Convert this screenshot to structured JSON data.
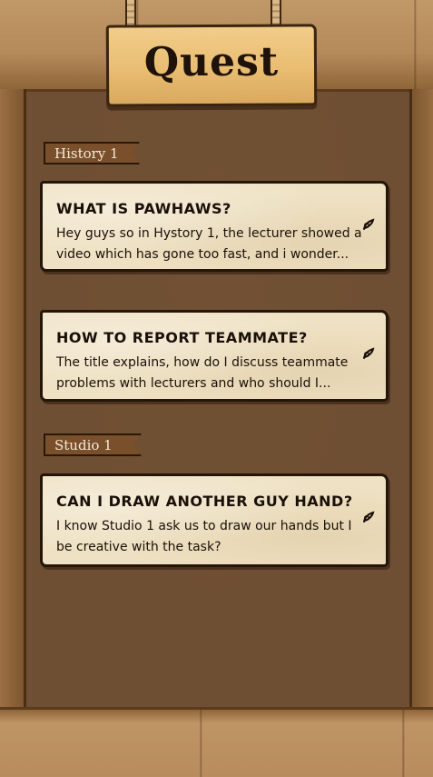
{
  "header": {
    "title": "Quest"
  },
  "sections": [
    {
      "label": "History 1",
      "quests": [
        {
          "title": "WHAT IS PAWHAWS?",
          "body": "Hey guys so in Hystory 1, the lecturer showed a video which has gone too fast, and i wonder..."
        },
        {
          "title": "HOW TO REPORT TEAMMATE?",
          "body": "The title explains, how do I discuss teammate problems with lecturers and who should I..."
        }
      ]
    },
    {
      "label": "Studio 1",
      "quests": [
        {
          "title": "CAN I DRAW ANOTHER GUY HAND?",
          "body": "I know Studio 1 ask us to draw our hands but I be creative with the task?"
        }
      ]
    }
  ],
  "icons": {
    "quest_indicator": "quill-icon"
  },
  "colors": {
    "board": "#6f4f33",
    "sign": "#e9bd72",
    "card": "#efe2c4",
    "ribbon": "#7a4f2c",
    "ink": "#1a1008"
  }
}
